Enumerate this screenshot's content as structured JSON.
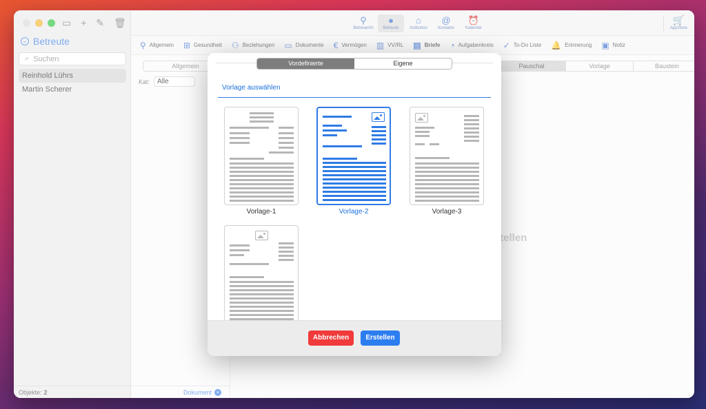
{
  "sidebar": {
    "title": "Betreute",
    "search_placeholder": "Suchen",
    "persons": [
      "Reinhold Lührs",
      "Martin Scherer"
    ],
    "footer_label": "Objekte:",
    "footer_count": "2"
  },
  "topbar": {
    "icons": [
      {
        "label": "Betreuer/in",
        "icon": "person-outline-icon"
      },
      {
        "label": "Betreute",
        "icon": "person-filled-icon"
      },
      {
        "label": "Institution",
        "icon": "building-icon"
      },
      {
        "label": "Kontakte",
        "icon": "at-sign-icon"
      },
      {
        "label": "Kalender",
        "icon": "alarm-clock-icon"
      }
    ],
    "appstore_label": "AppStore"
  },
  "navbar": {
    "items": [
      {
        "label": "Allgemein",
        "icon": "person-icon"
      },
      {
        "label": "Gesundheit",
        "icon": "first-aid-icon"
      },
      {
        "label": "Beziehungen",
        "icon": "people-icon"
      },
      {
        "label": "Dokumente",
        "icon": "folder-icon"
      },
      {
        "label": "Vermögen",
        "icon": "euro-icon"
      },
      {
        "label": "VV/RL",
        "icon": "books-icon"
      },
      {
        "label": "Briefe",
        "icon": "document-icon"
      },
      {
        "label": "Aufgabenkreis",
        "icon": "tasks-icon"
      },
      {
        "label": "To-Do Liste",
        "icon": "checkmark-icon"
      },
      {
        "label": "Erinnerung",
        "icon": "bell-icon"
      },
      {
        "label": "Notiz",
        "icon": "notepad-icon"
      }
    ]
  },
  "content": {
    "left_segment": "Allgemein",
    "kat_label": "Kat:",
    "kat_value": "Alle",
    "right_segments": [
      "Pauschal",
      "Vorlage",
      "Baustein"
    ],
    "empty_text": "rstellen",
    "footer_button": "Dokument"
  },
  "modal": {
    "tabs": [
      "Vordefinierte",
      "Eigene"
    ],
    "active_tab": 0,
    "heading": "Vorlage auswählen",
    "templates": [
      "Vorlage-1",
      "Vorlage-2",
      "Vorlage-3",
      ""
    ],
    "selected": 1,
    "cancel_label": "Abbrechen",
    "create_label": "Erstellen"
  },
  "colors": {
    "accent": "#2f7be5",
    "cancel": "#f13a3a",
    "create": "#2c7df0"
  }
}
